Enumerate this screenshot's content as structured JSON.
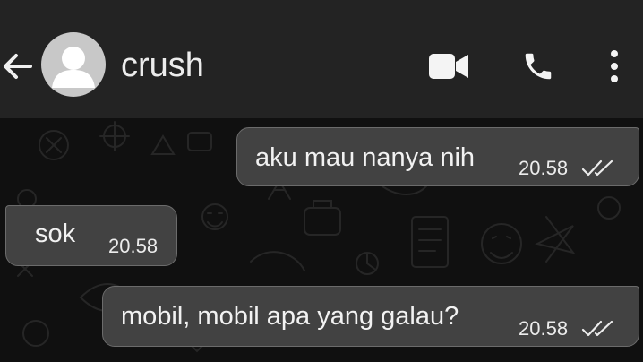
{
  "header": {
    "contact_name": "crush",
    "icons": [
      "back-arrow-icon",
      "avatar-icon",
      "video-call-icon",
      "phone-icon",
      "more-options-icon"
    ],
    "background": "#232323"
  },
  "messages": [
    {
      "direction": "outgoing",
      "text": "aku mau nanya nih",
      "time": "20.58",
      "status": "read"
    },
    {
      "direction": "incoming",
      "text": "sok",
      "time": "20.58"
    },
    {
      "direction": "outgoing",
      "text": "mobil, mobil apa yang galau?",
      "time": "20.58",
      "status": "read"
    }
  ],
  "colors": {
    "bubble": "#424242",
    "chat_background": "#101010",
    "text": "#f2f2f2"
  }
}
